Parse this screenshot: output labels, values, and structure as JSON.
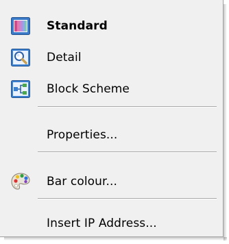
{
  "menu": {
    "items": [
      {
        "label": "Standard",
        "icon": "standard-view-icon",
        "bold": true
      },
      {
        "label": "Detail",
        "icon": "detail-magnifier-icon"
      },
      {
        "label": "Block Scheme",
        "icon": "block-scheme-icon"
      },
      {
        "label": "Properties..."
      },
      {
        "label": "Bar colour...",
        "icon": "palette-icon"
      },
      {
        "label": "Insert IP Address..."
      }
    ]
  },
  "colors": {
    "menu_background": "#f0f0f0",
    "separator": "#a8a8a8",
    "icon_blue": "#3b7fd1"
  }
}
